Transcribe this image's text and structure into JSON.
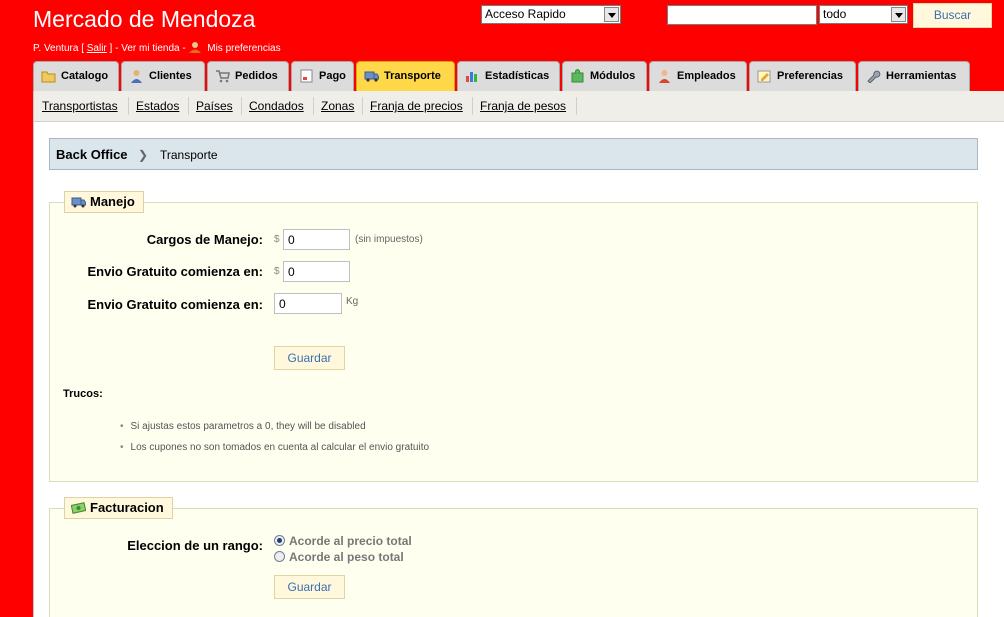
{
  "header": {
    "title": "Mercado de Mendoza",
    "user_name": "P. Ventura [",
    "logout_label": "Salir",
    "user_mid": "] - Ver mi tienda -",
    "preferences_label": "Mis preferencias",
    "quick_access_value": "Acceso Rapido",
    "search_value": "",
    "search_scope_value": "todo",
    "search_button": "Buscar"
  },
  "tabs": [
    {
      "label": "Catalogo",
      "icon": "folder-icon"
    },
    {
      "label": "Clientes",
      "icon": "user-icon"
    },
    {
      "label": "Pedidos",
      "icon": "cart-icon"
    },
    {
      "label": "Pago",
      "icon": "payment-icon"
    },
    {
      "label": "Transporte",
      "icon": "truck-icon",
      "active": true
    },
    {
      "label": "Estadísticas",
      "icon": "chart-icon"
    },
    {
      "label": "Módulos",
      "icon": "puzzle-icon"
    },
    {
      "label": "Empleados",
      "icon": "employee-icon"
    },
    {
      "label": "Preferencias",
      "icon": "preferences-icon"
    },
    {
      "label": "Herramientas",
      "icon": "wrench-icon"
    }
  ],
  "subnav": [
    "Transportistas",
    "Estados",
    "Países",
    "Condados",
    "Zonas",
    "Franja de precios",
    "Franja de pesos"
  ],
  "breadcrumb": {
    "root": "Back Office",
    "current": "Transporte"
  },
  "manejo": {
    "legend": "Manejo",
    "fields": [
      {
        "label": "Cargos de Manejo:",
        "currency": "$",
        "value": "0",
        "hint": "(sin impuestos)"
      },
      {
        "label": "Envio Gratuito comienza en:",
        "currency": "$",
        "value": "0",
        "hint": ""
      },
      {
        "label": "Envio Gratuito comienza en:",
        "currency": "",
        "value": "0",
        "hint": "Kg"
      }
    ],
    "save_button": "Guardar",
    "tips_title": "Trucos:",
    "tips": [
      "Si ajustas estos parametros a 0, they will be disabled",
      "Los cupones no son tomados en cuenta al calcular el envio gratuito"
    ]
  },
  "facturacion": {
    "legend": "Facturacion",
    "range_label": "Eleccion de un rango:",
    "options": [
      {
        "label": "Acorde al precio total",
        "checked": true
      },
      {
        "label": "Acorde al peso total",
        "checked": false
      }
    ],
    "save_button": "Guardar"
  }
}
